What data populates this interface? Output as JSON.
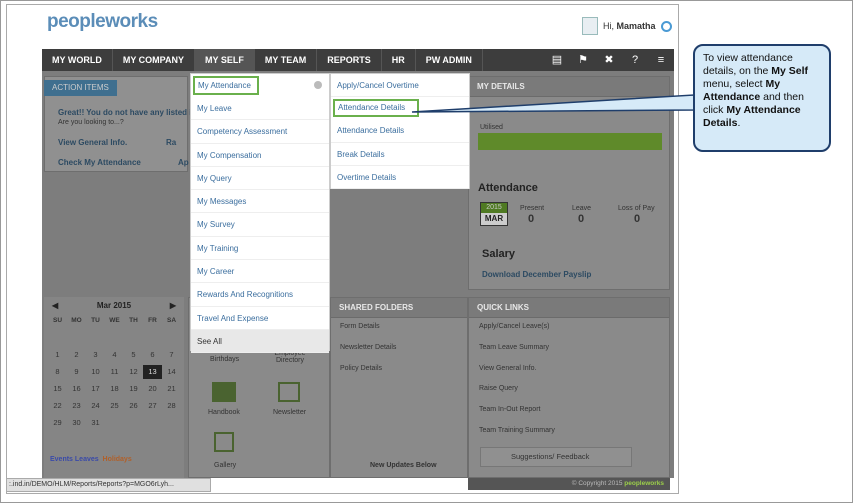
{
  "header": {
    "logo": "peopleworks",
    "greeting": "Hi, Mamatha",
    "user_name": "Mamatha"
  },
  "nav": {
    "items": [
      "MY WORLD",
      "MY COMPANY",
      "MY SELF",
      "MY TEAM",
      "REPORTS",
      "HR",
      "PW ADMIN"
    ],
    "active": "MY SELF",
    "icons": [
      "book-icon",
      "flag-icon",
      "tools-icon",
      "help-icon",
      "sitemap-icon"
    ]
  },
  "left": {
    "tab": "ACTION ITEMS",
    "greeting": "Great!! You do not have any listed it",
    "prompt": "Are you looking to...?",
    "links": [
      "View General Info.",
      "Check My Attendance",
      "Ra",
      "Ap"
    ]
  },
  "menu": {
    "level1": [
      "My Attendance",
      "My Leave",
      "Competency Assessment",
      "My Compensation",
      "My Query",
      "My Messages",
      "My Survey",
      "My Training",
      "My Career",
      "Rewards And Recognitions",
      "Travel And Expense",
      "See All"
    ],
    "level2": [
      "Apply/Cancel Overtime",
      "Attendance Details",
      "Attendance Details",
      "Break Details",
      "Overtime Details"
    ]
  },
  "my_details": {
    "title": "MY DETAILS",
    "utilised": "Utilised",
    "attendance_title": "Attendance",
    "year": "2015",
    "month": "MAR",
    "present_label": "Present",
    "present": "0",
    "leave_label": "Leave",
    "leave": "0",
    "lop_label": "Loss of Pay",
    "lop": "0",
    "salary_title": "Salary",
    "payslip": "Download December Payslip"
  },
  "calendar": {
    "title": "Mar 2015",
    "weekdays": [
      "SU",
      "MO",
      "TU",
      "WE",
      "TH",
      "FR",
      "SA"
    ],
    "rows": [
      [
        "",
        "",
        "",
        "",
        "",
        "",
        ""
      ],
      [
        "1",
        "2",
        "3",
        "4",
        "5",
        "6",
        "7"
      ],
      [
        "8",
        "9",
        "10",
        "11",
        "12",
        "13",
        "14"
      ],
      [
        "15",
        "16",
        "17",
        "18",
        "19",
        "20",
        "21"
      ],
      [
        "22",
        "23",
        "24",
        "25",
        "26",
        "27",
        "28"
      ],
      [
        "29",
        "30",
        "31",
        "",
        "",
        "",
        ""
      ]
    ],
    "today": "13",
    "legend_events": "Events Leaves",
    "legend_holidays": "Holidays"
  },
  "tiles": {
    "birthdays": "Birthdays",
    "directory": "Employee Directory",
    "handbook": "Handbook",
    "newsletter": "Newsletter",
    "gallery": "Gallery"
  },
  "shared_folders": {
    "title": "SHARED FOLDERS",
    "items": [
      "Form Details",
      "Newsletter Details",
      "Policy Details"
    ],
    "footer": "New Updates Below"
  },
  "quick_links": {
    "title": "QUICK LINKS",
    "items": [
      "Apply/Cancel Leave(s)",
      "Team Leave Summary",
      "View General Info.",
      "Raise Query",
      "Team In-Out Report",
      "Team Training Summary"
    ],
    "feedback": "Suggestions/ Feedback"
  },
  "status_url": ":.ind.in/DEMO/HLM/Reports/Reports?p=MGO6rLyh...",
  "copyright": "© Copyright 2015",
  "copyright_brand": "peopleworks",
  "callout": {
    "t1": "To view attendance details, on the ",
    "b1": "My Self",
    "t2": " menu, select ",
    "b2": "My Attendance",
    "t3": " and then click ",
    "b3": "My Attendance Details",
    "t4": "."
  },
  "colors": {
    "nav": "#3d3d3d",
    "highlight": "#6ab04c",
    "callout_bg": "#d6eaf8",
    "callout_border": "#1f3e6b",
    "link": "#3b6e9e"
  }
}
